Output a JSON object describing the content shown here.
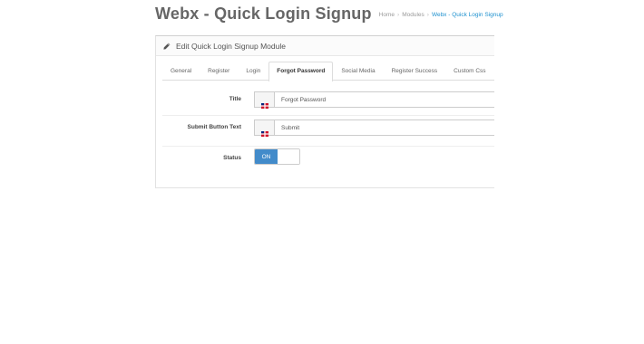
{
  "header": {
    "brand": "Webx",
    "title_rest": " - Quick Login Signup",
    "breadcrumb": [
      "Home",
      "Modules",
      "Webx - Quick Login Signup"
    ]
  },
  "panel": {
    "heading": "Edit Quick Login Signup Module"
  },
  "tabs": [
    {
      "label": "General"
    },
    {
      "label": "Register"
    },
    {
      "label": "Login"
    },
    {
      "label": "Forgot Password",
      "active": true
    },
    {
      "label": "Social Media"
    },
    {
      "label": "Register Success"
    },
    {
      "label": "Custom Css"
    }
  ],
  "form": {
    "title": {
      "label": "Title",
      "value": "Forgot Password"
    },
    "submit_text": {
      "label": "Submit Button Text",
      "value": "Submit"
    },
    "status": {
      "label": "Status",
      "on_label": "ON",
      "enabled": true
    }
  },
  "icons": {
    "edit": "pencil-icon",
    "language": "flag-icon"
  },
  "colors": {
    "accent": "#1e91cf",
    "toggle_on": "#428bca"
  }
}
